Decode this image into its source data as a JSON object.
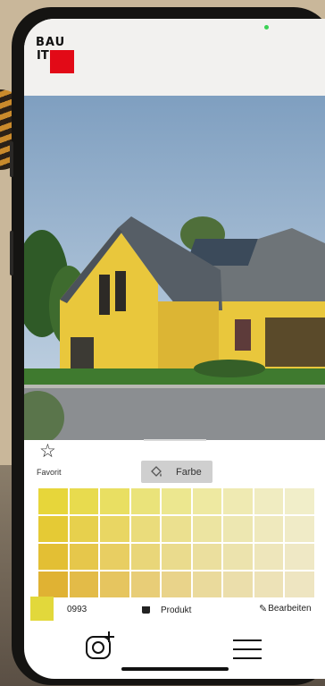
{
  "app": {
    "logo_text": "BAU",
    "logo_text_2": "IT",
    "logo_color": "#e20a17"
  },
  "photo": {
    "subject": "yellow-house"
  },
  "favorite": {
    "icon": "star-outline-icon",
    "label": "Favorit"
  },
  "mode_button": {
    "icon": "paint-bucket-icon",
    "label": "Farbe"
  },
  "palette": {
    "rows": [
      [
        "#e7d63a",
        "#e8db4e",
        "#e9df62",
        "#eae37a",
        "#ece78f",
        "#eee9a1",
        "#efeab2",
        "#f0ecc1",
        "#f1eec9"
      ],
      [
        "#e5ca35",
        "#e7d04d",
        "#e9d663",
        "#eadc7b",
        "#ebe08f",
        "#ece4a1",
        "#ede7b1",
        "#efe9bd",
        "#f0ebc7"
      ],
      [
        "#e3bf34",
        "#e6c74b",
        "#e8ce62",
        "#e9d679",
        "#eadb8d",
        "#ebdf9e",
        "#ece3ad",
        "#eee6bb",
        "#efe8c5"
      ],
      [
        "#e0b233",
        "#e3bb48",
        "#e6c55f",
        "#e8cd77",
        "#e9d38a",
        "#eada9c",
        "#ebdeab",
        "#ede2b7",
        "#eee5c1"
      ]
    ]
  },
  "selection": {
    "color": "#e2d83b",
    "code": "0993"
  },
  "actions": {
    "produkt_icon": "paint-pot-icon",
    "produkt_label": "Produkt",
    "edit_icon": "pencil-icon",
    "edit_label": "Bearbeiten"
  },
  "nav": {
    "camera_icon": "add-photo-icon",
    "menu_icon": "hamburger-menu-icon"
  }
}
